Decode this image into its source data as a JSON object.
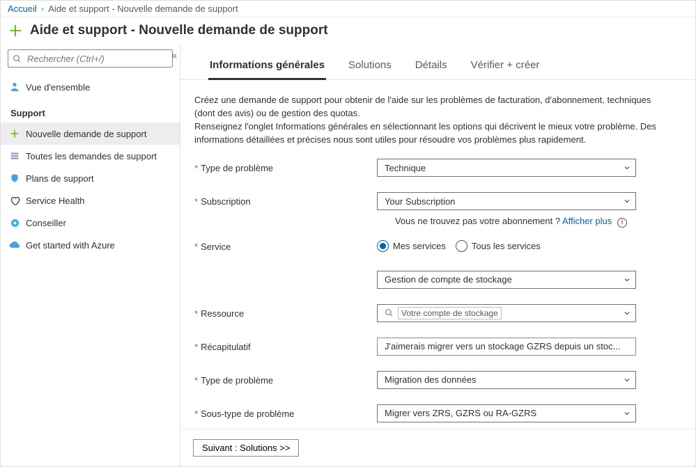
{
  "breadcrumb": {
    "home": "Accueil",
    "current": "Aide et support - Nouvelle demande de support"
  },
  "page_title": "Aide et support - Nouvelle demande de support",
  "sidebar": {
    "search_placeholder": "Rechercher (Ctrl+/)",
    "overview_label": "Vue d'ensemble",
    "section_title": "Support",
    "items": [
      {
        "icon": "plus-icon",
        "label": "Nouvelle demande de support",
        "active": true
      },
      {
        "icon": "list-icon",
        "label": "Toutes les demandes de support"
      },
      {
        "icon": "shield-icon",
        "label": "Plans de support"
      },
      {
        "icon": "heart-icon",
        "label": "Service Health"
      },
      {
        "icon": "advisor-icon",
        "label": "Conseiller"
      },
      {
        "icon": "cloud-icon",
        "label": "Get started with Azure"
      }
    ]
  },
  "tabs": [
    {
      "label": "Informations générales",
      "active": true
    },
    {
      "label": "Solutions"
    },
    {
      "label": "Détails"
    },
    {
      "label": "Vérifier + créer"
    }
  ],
  "intro_line1": "Créez une demande de support pour obtenir de l'aide sur les problèmes de facturation, d'abonnement, techniques (dont des avis) ou de gestion des quotas.",
  "intro_line2": "Renseignez l'onglet Informations générales en sélectionnant les options qui décrivent le mieux votre problème. Des informations détaillées et précises nous sont utiles pour résoudre vos problèmes plus rapidement.",
  "form": {
    "issue_type": {
      "label": "Type de problème",
      "value": "Technique"
    },
    "subscription": {
      "label": "Subscription",
      "value": "Your Subscription",
      "hint_prefix": "Vous ne trouvez pas votre abonnement ? ",
      "hint_link": "Afficher plus"
    },
    "service": {
      "label": "Service",
      "option_my": "Mes services",
      "option_all": "Tous les services",
      "value": "Gestion de compte de stockage"
    },
    "resource": {
      "label": "Ressource",
      "placeholder": "Votre compte de stockage"
    },
    "summary": {
      "label": "Récapitulatif",
      "value": "J'aimerais migrer vers un stockage GZRS depuis un stoc..."
    },
    "problem_type": {
      "label": "Type de problème",
      "value": "Migration des données"
    },
    "problem_subtype": {
      "label": "Sous-type de problème",
      "value": "Migrer vers ZRS, GZRS ou RA-GZRS"
    }
  },
  "footer": {
    "next": "Suivant : Solutions >>"
  }
}
